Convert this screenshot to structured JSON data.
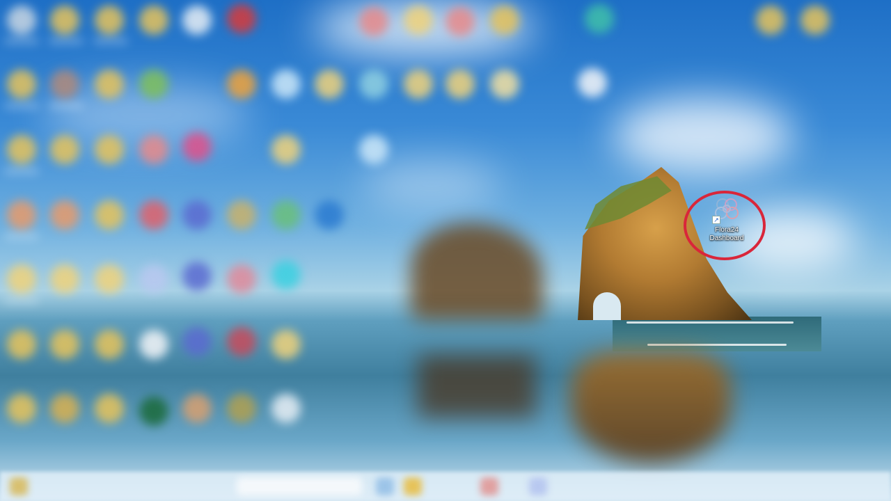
{
  "desktop": {
    "wallpaper": "seascape-with-rock-arch",
    "background_blurred": true
  },
  "shortcut": {
    "label_line1": "Flora24",
    "label_line2": "Dashboard",
    "icon": "flora-flower-icon",
    "overlay_icon": "shortcut-arrow-icon",
    "highlight_color": "#d9263a"
  },
  "colors": {
    "sky": "#1e6fc6",
    "rock": "#b27b32",
    "highlight": "#d9263a"
  }
}
